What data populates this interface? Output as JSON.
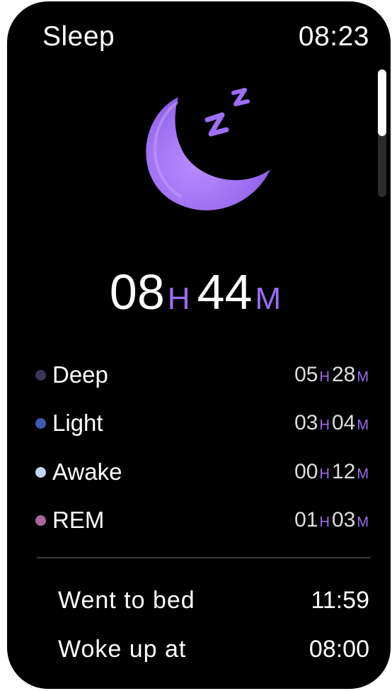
{
  "status_bar": {
    "title": "Sleep",
    "time": "08:23"
  },
  "icons": {
    "moon": "sleep-moon-zzz-icon",
    "scrollbar": "scrollbar"
  },
  "colors": {
    "background": "#000000",
    "accent": "#9b6cf0",
    "moon": "#a77df5"
  },
  "total": {
    "hours": "08",
    "hours_unit": "H",
    "minutes": "44",
    "minutes_unit": "M"
  },
  "stages": [
    {
      "label": "Deep",
      "color": "#3d3459",
      "hours": "05",
      "hours_unit": "H",
      "minutes": "28",
      "minutes_unit": "M"
    },
    {
      "label": "Light",
      "color": "#3f5ab5",
      "hours": "03",
      "hours_unit": "H",
      "minutes": "04",
      "minutes_unit": "M"
    },
    {
      "label": "Awake",
      "color": "#c6d4ff",
      "hours": "00",
      "hours_unit": "H",
      "minutes": "12",
      "minutes_unit": "M"
    },
    {
      "label": "REM",
      "color": "#a9689c",
      "hours": "01",
      "hours_unit": "H",
      "minutes": "03",
      "minutes_unit": "M"
    }
  ],
  "summary": {
    "bed_label": "Went to bed",
    "bed_time": "11:59",
    "wake_label": "Woke up at",
    "wake_time": "08:00"
  }
}
